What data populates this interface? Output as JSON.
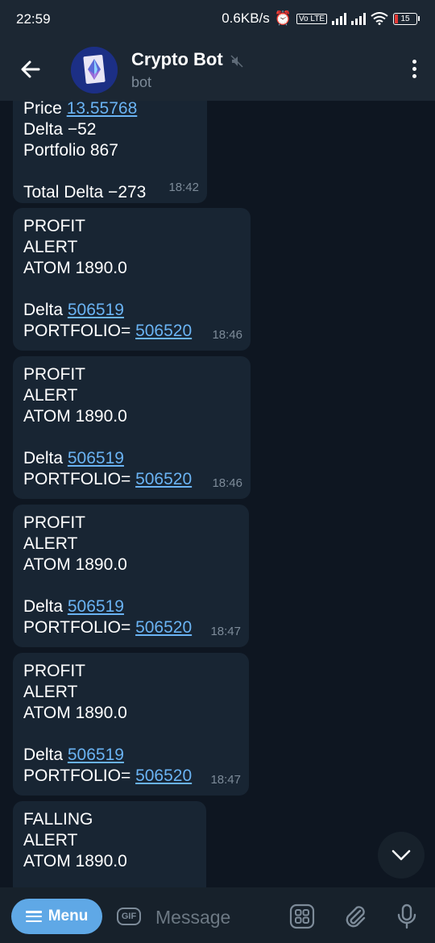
{
  "status": {
    "time": "22:59",
    "net_speed": "0.6KB/s",
    "volte": "Vo LTE",
    "battery": "15"
  },
  "header": {
    "title": "Crypto Bot",
    "subtitle": "bot"
  },
  "messages": [
    {
      "lines": [
        [
          {
            "t": "Price "
          },
          {
            "t": "13.55768",
            "link": true
          }
        ],
        [
          {
            "t": "Delta −52"
          }
        ],
        [
          {
            "t": "Portfolio 867"
          }
        ],
        [],
        [
          {
            "t": "Total Delta −273"
          }
        ]
      ],
      "time": "18:42"
    },
    {
      "lines": [
        [
          {
            "t": "PROFIT"
          }
        ],
        [
          {
            "t": "ALERT"
          }
        ],
        [
          {
            "t": "ATOM 1890.0"
          }
        ],
        [],
        [
          {
            "t": "Delta "
          },
          {
            "t": "506519",
            "link": true
          }
        ],
        [
          {
            "t": "PORTFOLIO= "
          },
          {
            "t": "506520",
            "link": true
          }
        ]
      ],
      "time": "18:46"
    },
    {
      "lines": [
        [
          {
            "t": "PROFIT"
          }
        ],
        [
          {
            "t": "ALERT"
          }
        ],
        [
          {
            "t": "ATOM 1890.0"
          }
        ],
        [],
        [
          {
            "t": "Delta "
          },
          {
            "t": "506519",
            "link": true
          }
        ],
        [
          {
            "t": "PORTFOLIO= "
          },
          {
            "t": "506520",
            "link": true
          }
        ]
      ],
      "time": "18:46"
    },
    {
      "lines": [
        [
          {
            "t": "PROFIT"
          }
        ],
        [
          {
            "t": "ALERT"
          }
        ],
        [
          {
            "t": "ATOM 1890.0"
          }
        ],
        [],
        [
          {
            "t": "Delta "
          },
          {
            "t": "506519",
            "link": true
          }
        ],
        [
          {
            "t": "PORTFOLIO= "
          },
          {
            "t": "506520",
            "link": true
          }
        ]
      ],
      "time": "18:47"
    },
    {
      "lines": [
        [
          {
            "t": "PROFIT"
          }
        ],
        [
          {
            "t": "ALERT"
          }
        ],
        [
          {
            "t": "ATOM 1890.0"
          }
        ],
        [],
        [
          {
            "t": "Delta "
          },
          {
            "t": "506519",
            "link": true
          }
        ],
        [
          {
            "t": "PORTFOLIO= "
          },
          {
            "t": "506520",
            "link": true
          }
        ]
      ],
      "time": "18:47"
    },
    {
      "lines": [
        [
          {
            "t": "FALLING"
          }
        ],
        [
          {
            "t": "ALERT"
          }
        ],
        [
          {
            "t": "ATOM 1890.0"
          }
        ]
      ],
      "time": ""
    }
  ],
  "input": {
    "menu_label": "Menu",
    "gif_label": "GIF",
    "placeholder": "Message"
  },
  "icons": {
    "back": "arrow-left-icon",
    "mute": "muted-speaker-icon",
    "more": "kebab-menu-icon",
    "scroll": "chevron-down-icon",
    "stickers": "sticker-grid-icon",
    "attach": "paperclip-icon",
    "mic": "microphone-icon"
  },
  "colors": {
    "background": "#0e1621",
    "bubble": "#182533",
    "link": "#6ab3f3",
    "accent": "#5fa8e6"
  }
}
